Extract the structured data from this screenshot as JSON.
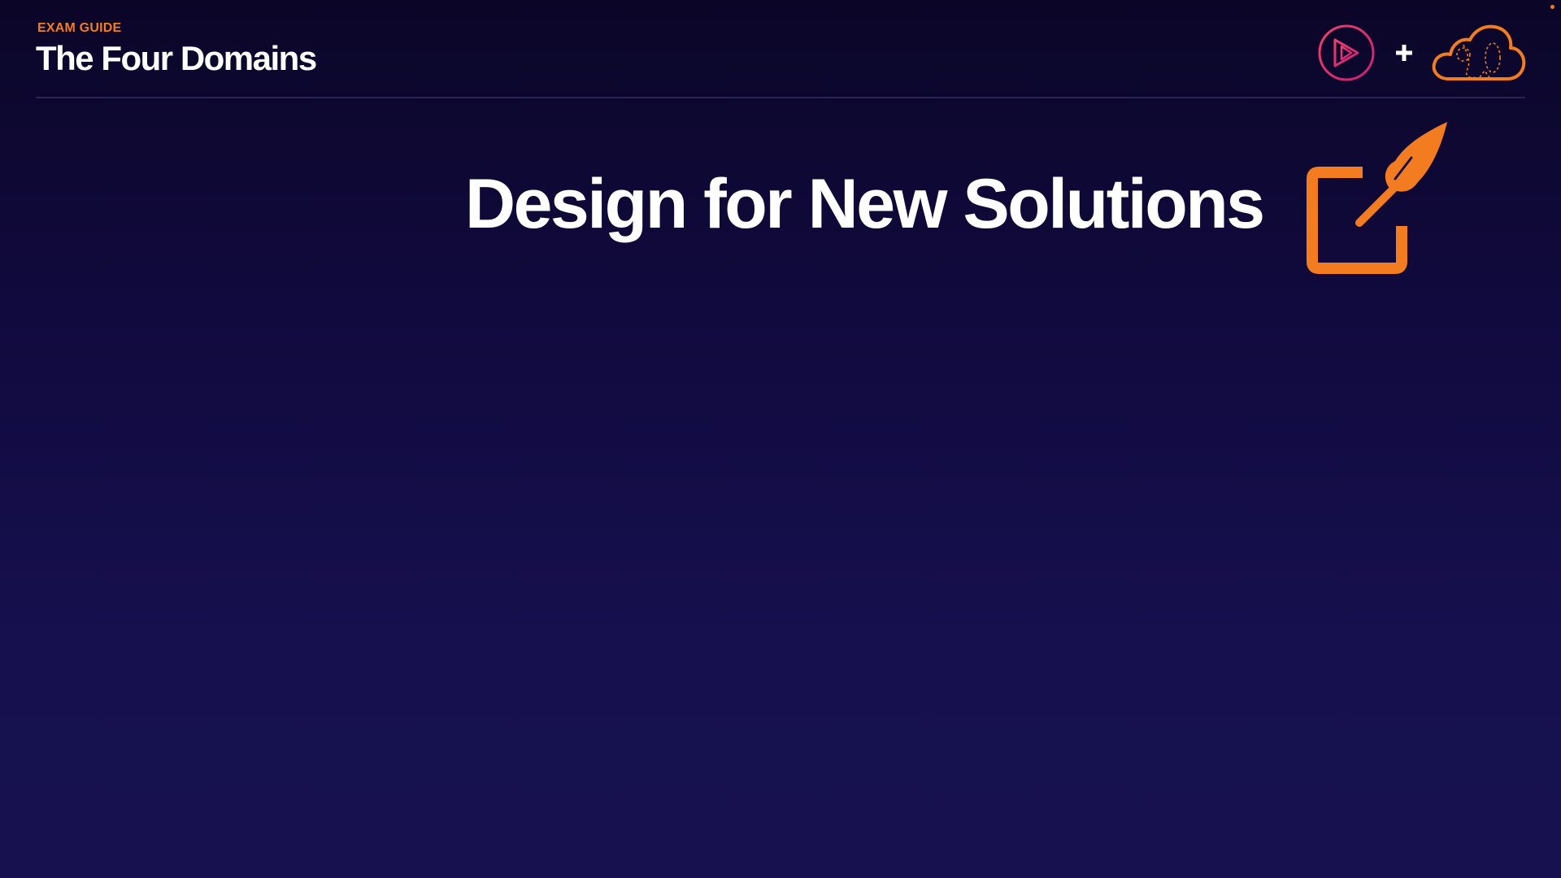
{
  "header": {
    "eyebrow": "EXAM GUIDE",
    "title": "The Four Domains"
  },
  "logos": {
    "left_icon": "play-circle-icon",
    "separator": "plus-icon",
    "right_icon": "cloud-icon"
  },
  "hero": {
    "title": "Design for New Solutions",
    "icon": "edit-pencil-icon"
  },
  "colors": {
    "accent_orange": "#f47c20",
    "logo_pink": "#e0246a",
    "background_top": "#0b0628",
    "background_bottom": "#17124f",
    "text": "#ffffff"
  }
}
